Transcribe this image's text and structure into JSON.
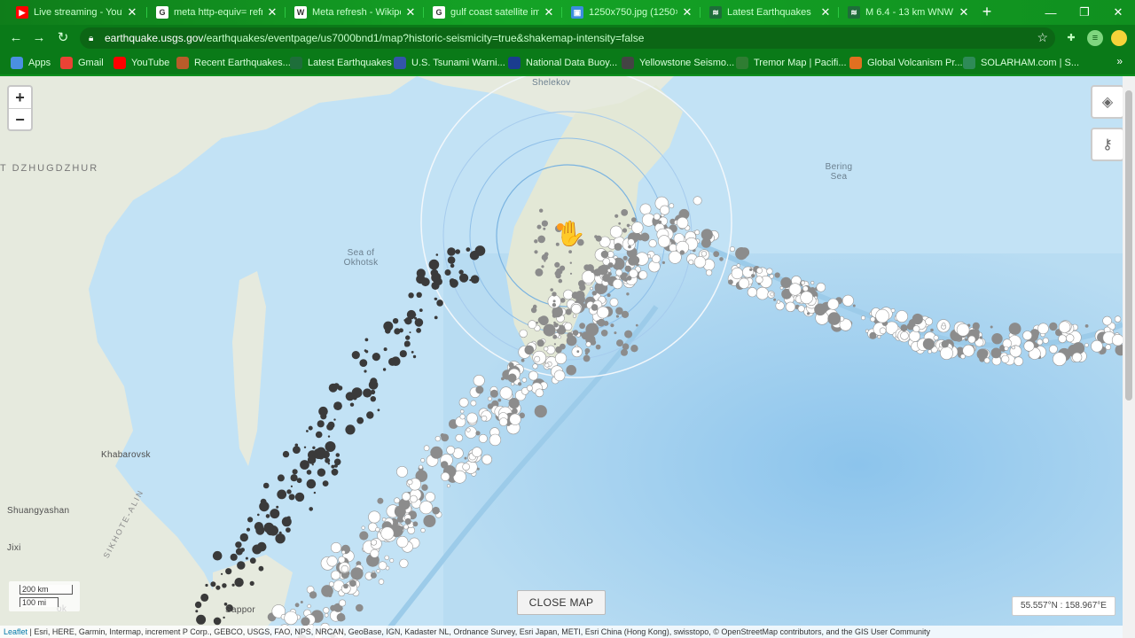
{
  "tabs": [
    {
      "title": "Live streaming - YouTu",
      "icon": "youtube-icon",
      "color": "#ff0000",
      "glyph": "▶"
    },
    {
      "title": "meta http-equiv= refre",
      "icon": "google-icon",
      "color": "#ffffff",
      "glyph": "G"
    },
    {
      "title": "Meta refresh - Wikipec",
      "icon": "wikipedia-icon",
      "color": "#ffffff",
      "glyph": "W"
    },
    {
      "title": "gulf coast satellite ima",
      "icon": "google-icon",
      "color": "#ffffff",
      "glyph": "G"
    },
    {
      "title": "1250x750.jpg (1250×7",
      "icon": "image-icon",
      "color": "#3b8dde",
      "glyph": "▣"
    },
    {
      "title": "Latest Earthquakes",
      "icon": "usgs-icon",
      "color": "#1e6e3a",
      "glyph": "≋"
    },
    {
      "title": "M 6.4 - 13 km WNW o",
      "icon": "usgs-icon",
      "color": "#1e6e3a",
      "glyph": "≋"
    }
  ],
  "address": {
    "domain": "earthquake.usgs.gov",
    "path": "/earthquakes/eventpage/us7000bnd1/map?historic-seismicity=true&shakemap-intensity=false"
  },
  "bookmarks": [
    {
      "label": "Apps"
    },
    {
      "label": "Gmail"
    },
    {
      "label": "YouTube"
    },
    {
      "label": "Recent Earthquakes..."
    },
    {
      "label": "Latest Earthquakes"
    },
    {
      "label": "U.S. Tsunami Warni..."
    },
    {
      "label": "National Data Buoy..."
    },
    {
      "label": "Yellowstone Seismo..."
    },
    {
      "label": "Tremor Map | Pacifi..."
    },
    {
      "label": "Global Volcanism Pr..."
    },
    {
      "label": "SOLARHAM.com | S..."
    }
  ],
  "bookmarks_more": "»",
  "map": {
    "labels": {
      "shelekov": "Shelekov",
      "dzhugdzhur": "T DZHUGDZHUR",
      "okhotsk_line1": "Sea of",
      "okhotsk_line2": "Okhotsk",
      "bering_line1": "Bering",
      "bering_line2": "Sea",
      "khabarovsk": "Khabarovsk",
      "shuangyashan": "Shuangyashan",
      "jixi": "Jixi",
      "sikhote": "SIKHOTE-ALIN",
      "sapporo": "Sappor",
      "vladivostok": "ok"
    },
    "zoom_in": "+",
    "zoom_out": "−",
    "scale_km": "200 km",
    "scale_mi": "100 mi",
    "close_map": "CLOSE MAP",
    "coordinates": "55.557°N : 158.967°E",
    "attribution_leaflet": "Leaflet",
    "attribution_text": " | Esri, HERE, Garmin, Intermap, increment P Corp., GEBCO, USGS, FAO, NPS, NRCAN, GeoBase, IGN, Kadaster NL, Ordnance Survey, Esri Japan, METI, Esri China (Hong Kong), swisstopo, © OpenStreetMap contributors, and the GIS User Community"
  },
  "colors": {
    "sea": "#b8dcf2",
    "land": "#e9ecdf",
    "deep_quake": "#3a3a3a",
    "mid_quake": "#8c8c8c",
    "shallow_quake": "#ffffff"
  }
}
